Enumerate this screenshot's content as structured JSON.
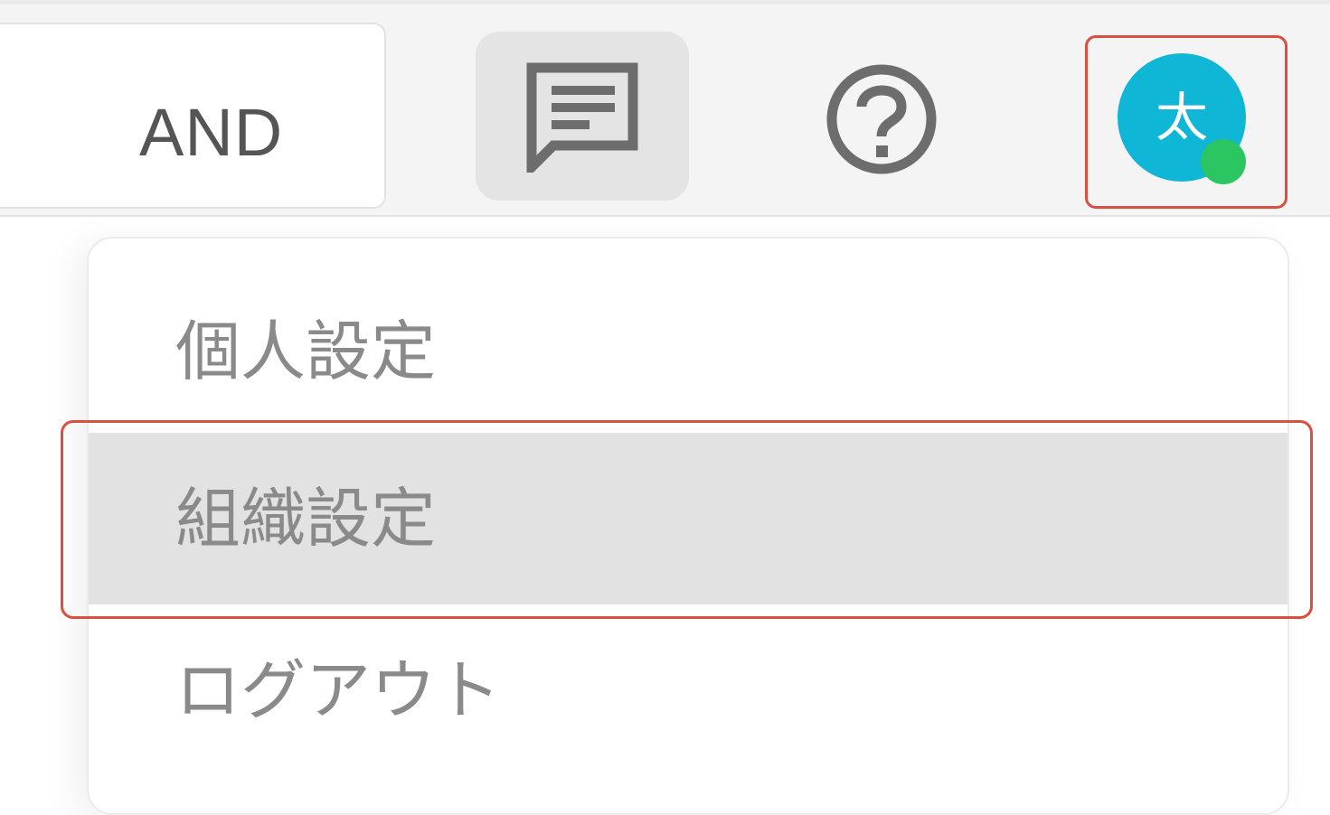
{
  "header": {
    "search": {
      "operator": "AND"
    },
    "chat_button": {
      "icon": "message-icon"
    },
    "help_button": {
      "icon": "help-icon"
    },
    "user": {
      "avatar_initial": "太",
      "status": "online",
      "avatar_color": "#0fb6d6",
      "status_color": "#2bc562"
    }
  },
  "user_menu": {
    "items": [
      {
        "label": "個人設定",
        "selected": false
      },
      {
        "label": "組織設定",
        "selected": true
      },
      {
        "label": "ログアウト",
        "selected": false
      }
    ]
  },
  "colors": {
    "highlight_border": "#d9503f",
    "selected_item_bg": "#e2e2e2",
    "menu_text": "#8a8a8a"
  }
}
